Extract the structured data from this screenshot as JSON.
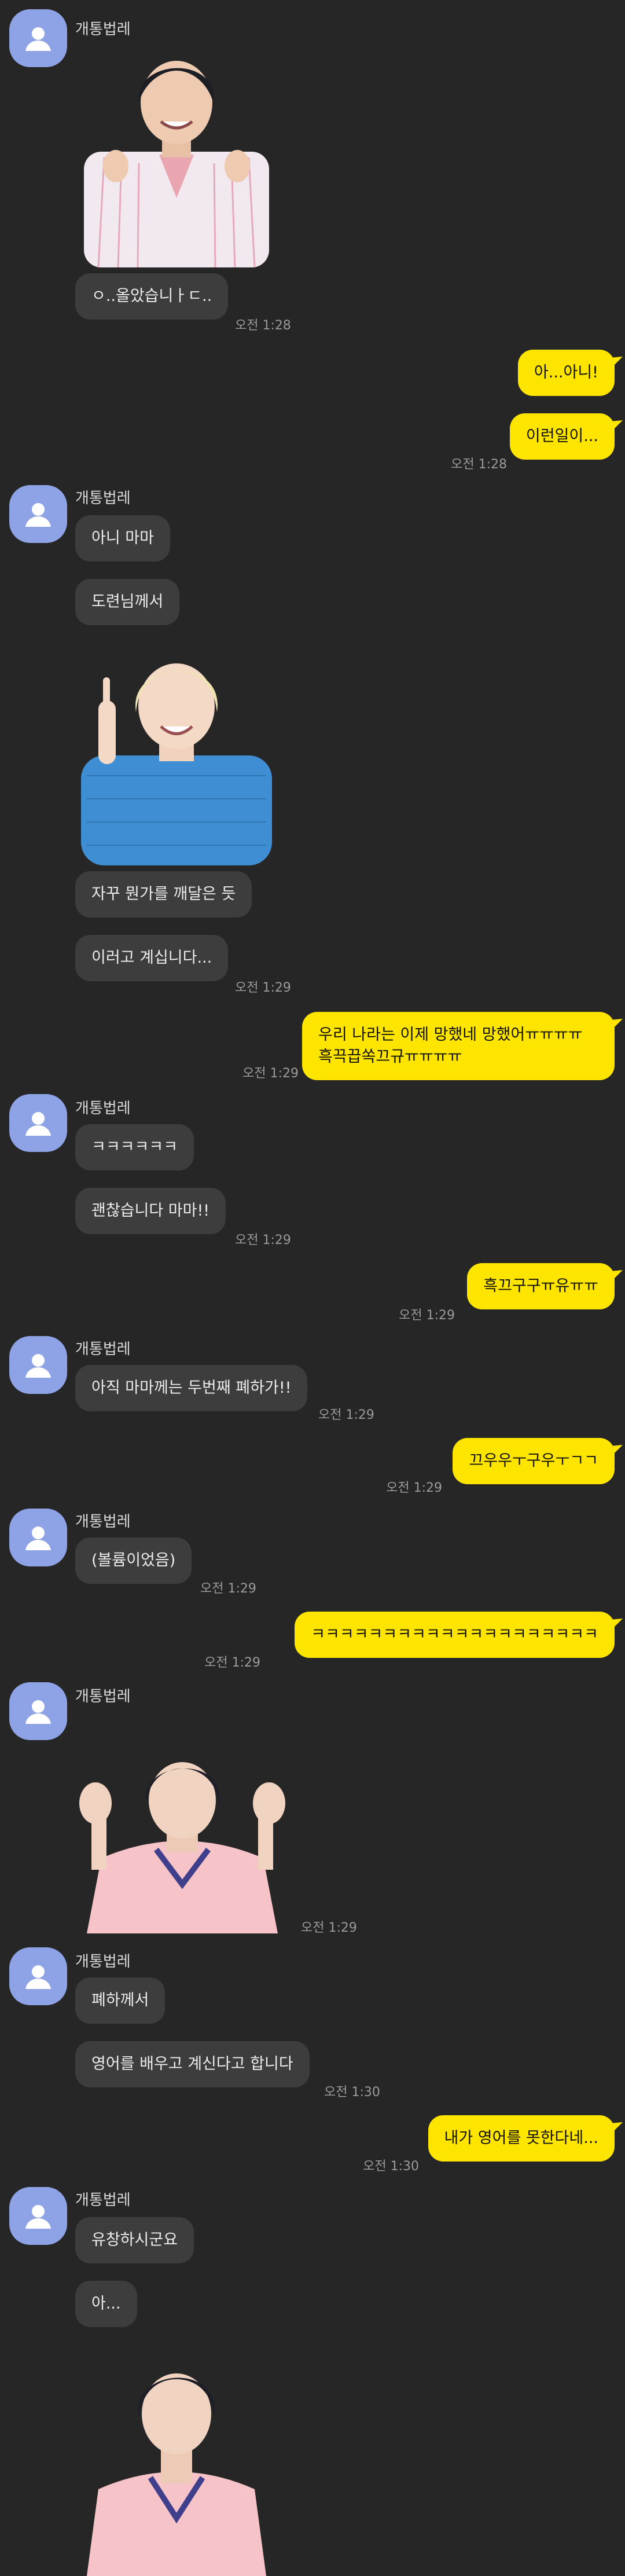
{
  "sender_name": "개통법레",
  "items": [
    {
      "type": "name",
      "text": "개통법레"
    },
    {
      "type": "in",
      "text": "ㅇ..올았습니ㅏㄷ.."
    },
    {
      "type": "time",
      "text": "오전 1:28"
    },
    {
      "type": "out",
      "text": "아...아니!"
    },
    {
      "type": "out",
      "text": "이런일이..."
    },
    {
      "type": "time",
      "text": "오전 1:28"
    },
    {
      "type": "name",
      "text": "개통법레"
    },
    {
      "type": "in",
      "text": "아니 마마"
    },
    {
      "type": "in",
      "text": "도련님께서"
    },
    {
      "type": "in",
      "text": "자꾸 뭔가를 깨달은 듯"
    },
    {
      "type": "in",
      "text": "이러고 계십니다..."
    },
    {
      "type": "time",
      "text": "오전 1:29"
    },
    {
      "type": "out",
      "text": "우리 나라는 이제 망했네 망했어ㅠㅠㅠㅠ\n흑끅끕쏙끄규ㅠㅠㅠㅠ"
    },
    {
      "type": "time",
      "text": "오전 1:29"
    },
    {
      "type": "name",
      "text": "개통법레"
    },
    {
      "type": "in",
      "text": "ㅋㅋㅋㅋㅋㅋ"
    },
    {
      "type": "in",
      "text": "괜찮습니다 마마!!"
    },
    {
      "type": "time",
      "text": "오전 1:29"
    },
    {
      "type": "out",
      "text": "흑끄구구ㅠ유ㅠㅠ"
    },
    {
      "type": "time",
      "text": "오전 1:29"
    },
    {
      "type": "name",
      "text": "개통법레"
    },
    {
      "type": "in",
      "text": "아직 마마께는 두번째 폐하가!!"
    },
    {
      "type": "time",
      "text": "오전 1:29"
    },
    {
      "type": "out",
      "text": "끄우우ㅜ구우ㅜㄱㄱ"
    },
    {
      "type": "time",
      "text": "오전 1:29"
    },
    {
      "type": "name",
      "text": "개통법레"
    },
    {
      "type": "in",
      "text": "(볼륨이었음)"
    },
    {
      "type": "time",
      "text": "오전 1:29"
    },
    {
      "type": "out",
      "text": "ㅋㅋㅋㅋㅋㅋㅋㅋㅋㅋㅋㅋㅋㅋㅋㅋㅋㅋㅋㅋ"
    },
    {
      "type": "time",
      "text": "오전 1:29"
    },
    {
      "type": "name",
      "text": "개통법레"
    },
    {
      "type": "time",
      "text": "오전 1:29"
    },
    {
      "type": "name",
      "text": "개통법레"
    },
    {
      "type": "in",
      "text": "폐하께서"
    },
    {
      "type": "in",
      "text": "영어를 배우고 계신다고 합니다"
    },
    {
      "type": "time",
      "text": "오전 1:30"
    },
    {
      "type": "out",
      "text": "내가 영어를 못한다네..."
    },
    {
      "type": "time",
      "text": "오전 1:30"
    },
    {
      "type": "name",
      "text": "개통법레"
    },
    {
      "type": "in",
      "text": "유창하시군요"
    },
    {
      "type": "in",
      "text": "아..."
    }
  ],
  "colors": {
    "background": "#262626",
    "incoming_bubble": "#3d3d3d",
    "outgoing_bubble": "#fee500",
    "avatar": "#8ea3e6"
  },
  "icons": {
    "avatar": "person-silhouette-icon"
  }
}
